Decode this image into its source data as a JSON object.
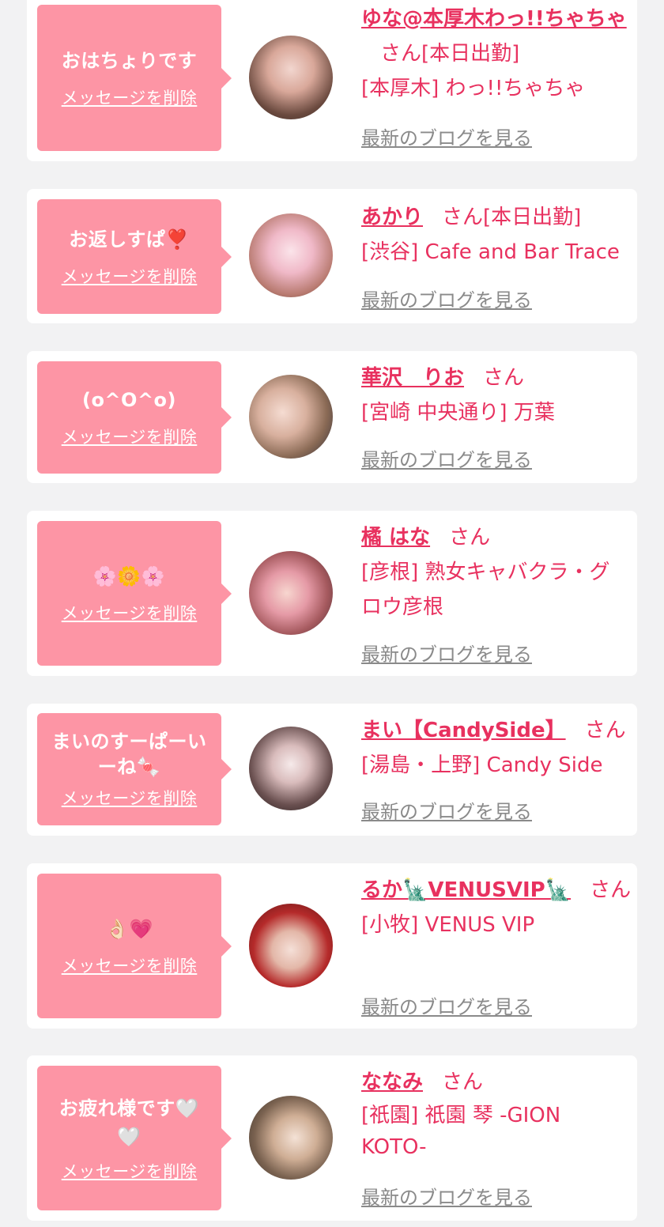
{
  "common": {
    "delete_label": "メッセージを削除",
    "blog_label": "最新のブログを見る",
    "san": "さん"
  },
  "cards": [
    {
      "message": "おはちょりです",
      "name": "ゆな@本厚木わっ!!ちゃちゃ",
      "status": "[本日出勤]",
      "shop": "[本厚木] わっ!!ちゃちゃ",
      "avatar": "avatar-photo"
    },
    {
      "message": "お返しすぱ❣️",
      "name": "あかり",
      "status": "[本日出勤]",
      "shop": "[渋谷] Cafe and Bar Trace",
      "avatar": "avatar-photo"
    },
    {
      "message": "(o^O^o)",
      "name": "華沢　りお",
      "status": "",
      "shop": "[宮崎 中央通り] 万葉",
      "avatar": "avatar-photo"
    },
    {
      "message": "🌸🌼🌸",
      "name": "橘 はな",
      "status": "",
      "shop": "[彦根] 熟女キャバクラ・グロウ彦根",
      "avatar": "avatar-photo"
    },
    {
      "message": "まいのすーぱーいーね🍬",
      "name": "まい【CandySide】",
      "status": "",
      "shop": "[湯島・上野] Candy Side",
      "avatar": "avatar-photo"
    },
    {
      "message": "👌🏻💗",
      "name": "るか🗽VENUSVIP🗽",
      "status": "",
      "shop": "[小牧] VENUS VIP",
      "avatar": "avatar-photo"
    },
    {
      "message": "お疲れ様です🤍🤍",
      "name": "ななみ",
      "status": "",
      "shop": "[祇園] 祇園 琴 -GION KOTO-",
      "avatar": "avatar-photo"
    }
  ],
  "colors": {
    "accent": "#e8315f",
    "bubble": "#fd95a5",
    "background": "#f2f2f3",
    "link_gray": "#8a8a8a"
  }
}
